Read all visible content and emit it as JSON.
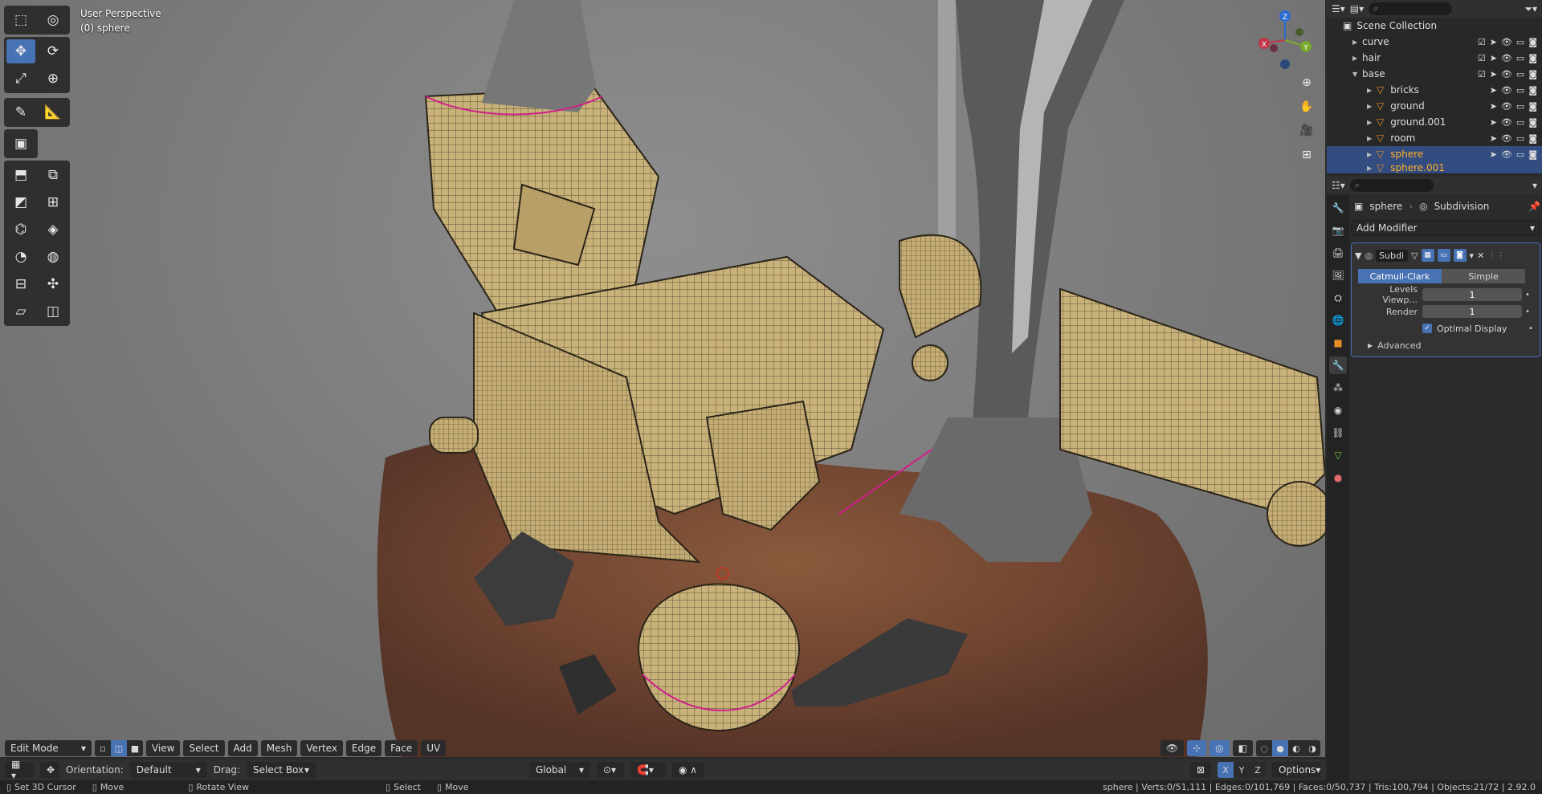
{
  "viewport": {
    "view_name": "User Perspective",
    "object_name": "(0) sphere"
  },
  "header": {
    "mode": "Edit Mode",
    "menus": [
      "View",
      "Select",
      "Add",
      "Mesh",
      "Vertex",
      "Edge",
      "Face",
      "UV"
    ]
  },
  "tool_settings": {
    "orientation_label": "Orientation:",
    "orientation_value": "Default",
    "drag_label": "Drag:",
    "drag_value": "Select Box",
    "transform_orientation": "Global",
    "options_label": "Options"
  },
  "outliner": {
    "root": "Scene Collection",
    "items": [
      {
        "name": "curve",
        "indent": 1
      },
      {
        "name": "hair",
        "indent": 1
      },
      {
        "name": "base",
        "indent": 1
      },
      {
        "name": "bricks",
        "indent": 2
      },
      {
        "name": "ground",
        "indent": 2
      },
      {
        "name": "ground.001",
        "indent": 2
      },
      {
        "name": "room",
        "indent": 2
      },
      {
        "name": "sphere",
        "indent": 2,
        "selected": true
      },
      {
        "name": "sphere.001",
        "indent": 2
      }
    ]
  },
  "properties": {
    "object": "sphere",
    "modifier_label": "Subdivision",
    "add_modifier": "Add Modifier",
    "modifier_short": "Subdi",
    "type_a": "Catmull-Clark",
    "type_b": "Simple",
    "levels_label": "Levels Viewp...",
    "levels_value": "1",
    "render_label": "Render",
    "render_value": "1",
    "optimal_display": "Optimal Display",
    "advanced": "Advanced"
  },
  "gizmo": {
    "x": "X",
    "y": "Y",
    "z": "Z"
  },
  "status": {
    "hint1": "Set 3D Cursor",
    "hint2": "Move",
    "hint3": "Rotate View",
    "hint4": "Select",
    "hint5": "Move",
    "stats": "sphere | Verts:0/51,111 | Edges:0/101,769 | Faces:0/50,737 | Tris:100,794 | Objects:21/72 | 2.92.0"
  },
  "colors": {
    "accent": "#4772b3",
    "mesh": "#c9b27a",
    "rock": "#7a4a30",
    "selected_name": "#ffaf29"
  }
}
